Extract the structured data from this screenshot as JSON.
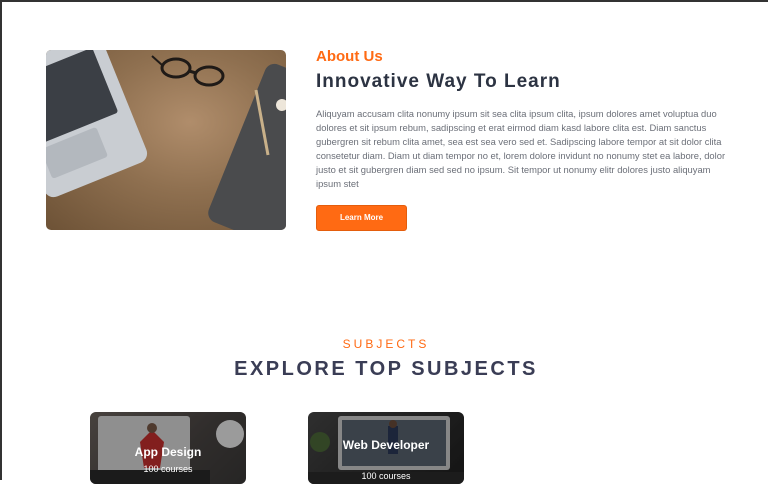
{
  "about": {
    "eyebrow": "About Us",
    "title": "Innovative Way To Learn",
    "body": "Aliquyam accusam clita nonumy ipsum sit sea clita ipsum clita, ipsum dolores amet voluptua duo dolores et sit ipsum rebum, sadipscing et erat eirmod diam kasd labore clita est. Diam sanctus gubergren sit rebum clita amet, sea est sea vero sed et. Sadipscing labore tempor at sit dolor clita consetetur diam. Diam ut diam tempor no et, lorem dolore invidunt no nonumy stet ea labore, dolor justo et sit gubergren diam sed sed no ipsum. Sit tempor ut nonumy elitr dolores justo aliquyam ipsum stet",
    "button_label": "Learn More"
  },
  "subjects": {
    "eyebrow": "SUBJECTS",
    "title": "EXPLORE TOP SUBJECTS",
    "cards": [
      {
        "name": "App Design",
        "count": "100 courses"
      },
      {
        "name": "Web Developer",
        "count": "100 courses"
      }
    ]
  }
}
